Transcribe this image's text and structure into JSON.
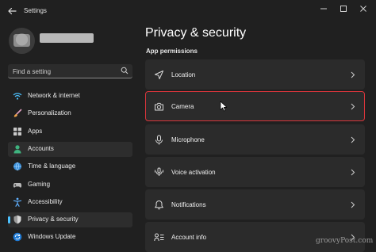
{
  "window": {
    "title": "Settings",
    "controls": [
      "minimize-icon",
      "maximize-icon",
      "close-icon"
    ]
  },
  "search": {
    "placeholder": "Find a setting"
  },
  "sidebar": {
    "items": [
      {
        "label": "Network & internet",
        "icon": "wifi-icon"
      },
      {
        "label": "Personalization",
        "icon": "brush-icon"
      },
      {
        "label": "Apps",
        "icon": "apps-icon"
      },
      {
        "label": "Accounts",
        "icon": "person-icon"
      },
      {
        "label": "Time & language",
        "icon": "globe-clock-icon"
      },
      {
        "label": "Gaming",
        "icon": "gamepad-icon"
      },
      {
        "label": "Accessibility",
        "icon": "accessibility-icon"
      },
      {
        "label": "Privacy & security",
        "icon": "shield-icon",
        "selected": true
      },
      {
        "label": "Windows Update",
        "icon": "update-icon"
      }
    ]
  },
  "main": {
    "title": "Privacy & security",
    "section": "App permissions",
    "rows": [
      {
        "label": "Location",
        "icon": "location-arrow-icon"
      },
      {
        "label": "Camera",
        "icon": "camera-icon",
        "highlighted": true
      },
      {
        "label": "Microphone",
        "icon": "microphone-icon"
      },
      {
        "label": "Voice activation",
        "icon": "voice-activation-icon"
      },
      {
        "label": "Notifications",
        "icon": "bell-icon"
      },
      {
        "label": "Account info",
        "icon": "account-info-icon"
      }
    ]
  },
  "watermark": "groovyPost.com",
  "colors": {
    "accent": "#4cc2ff",
    "highlight_border": "#d8353b",
    "background": "#202020",
    "card": "#2b2b2b"
  }
}
